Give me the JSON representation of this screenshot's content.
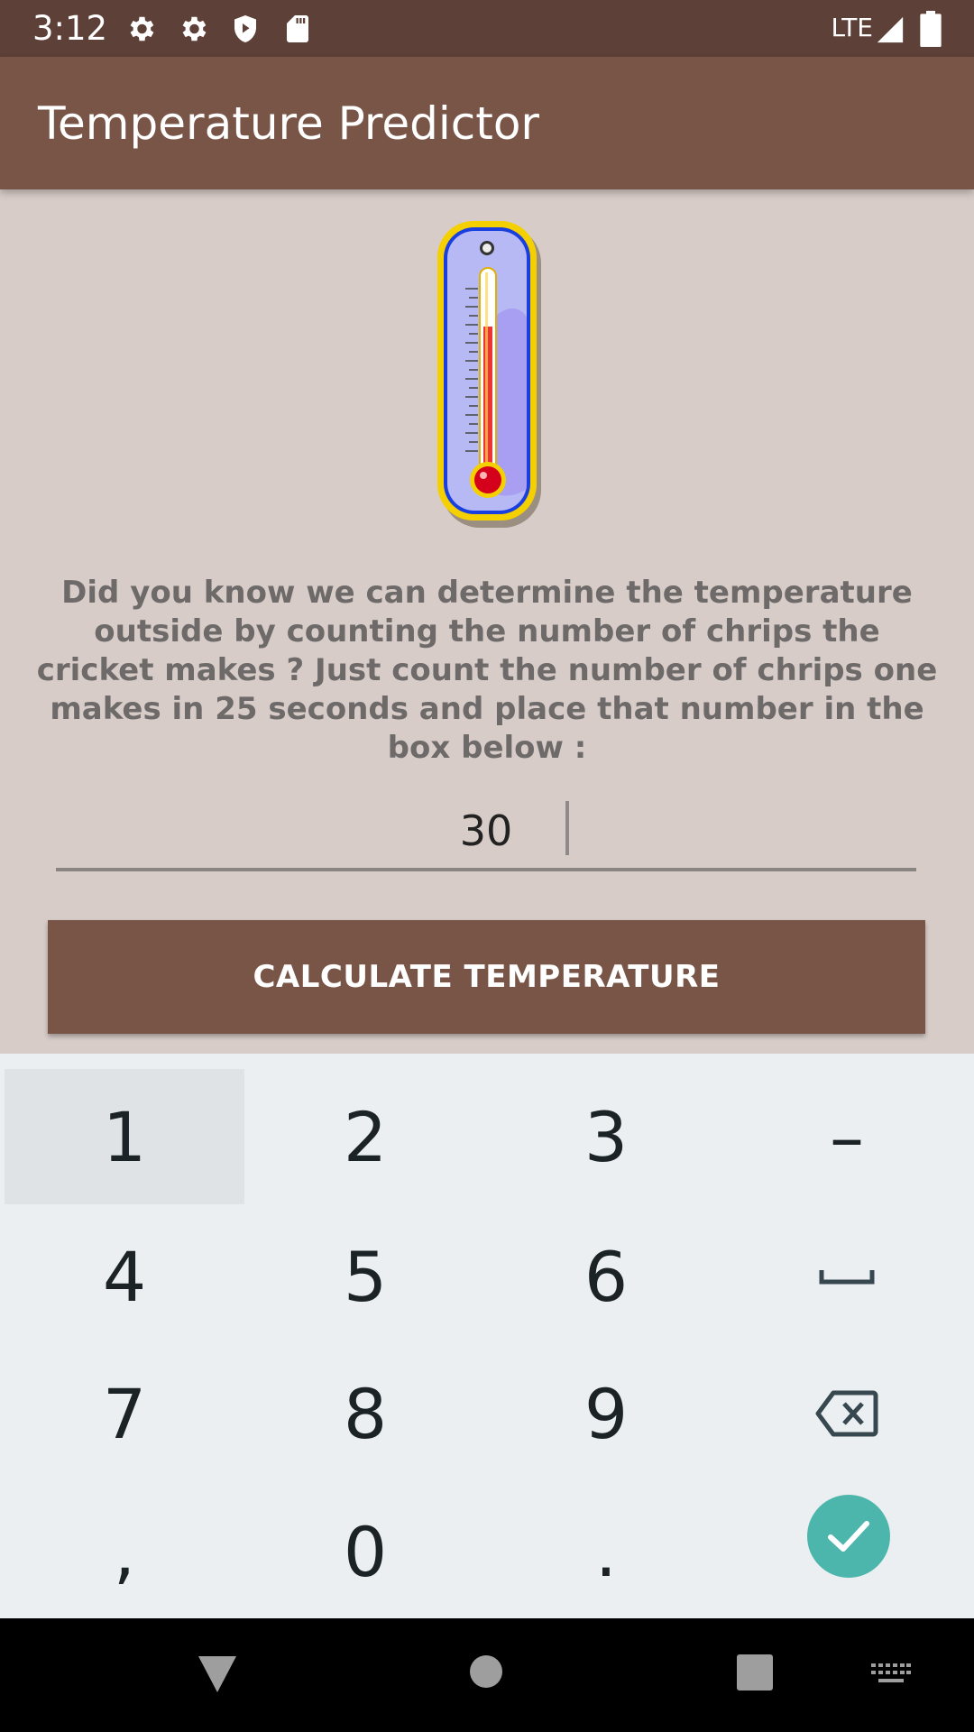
{
  "status_bar": {
    "time": "3:12",
    "network": "LTE",
    "icons": [
      "gear-icon",
      "gear-icon",
      "shield-play-icon",
      "sd-card-icon",
      "signal-icon",
      "battery-icon"
    ]
  },
  "app_bar": {
    "title": "Temperature Predictor"
  },
  "main": {
    "image_icon": "thermometer-icon",
    "intro_text": "Did you know we can determine the temperature outside by counting the number of chrips the cricket makes ? Just count the number of chrips one makes in 25 seconds and place that number in the box below :",
    "chirp_input": {
      "value": "30"
    },
    "calculate_button": "CALCULATE TEMPERATURE"
  },
  "keyboard": {
    "keys": [
      {
        "label": "1",
        "name": "key-1"
      },
      {
        "label": "2",
        "name": "key-2"
      },
      {
        "label": "3",
        "name": "key-3"
      },
      {
        "label": "–",
        "name": "key-minus"
      },
      {
        "label": "4",
        "name": "key-4"
      },
      {
        "label": "5",
        "name": "key-5"
      },
      {
        "label": "6",
        "name": "key-6"
      },
      {
        "label": "7",
        "name": "key-7"
      },
      {
        "label": "8",
        "name": "key-8"
      },
      {
        "label": "9",
        "name": "key-9"
      },
      {
        "label": ",",
        "name": "key-comma"
      },
      {
        "label": "0",
        "name": "key-0"
      },
      {
        "label": ".",
        "name": "key-period"
      }
    ],
    "icons": [
      "space-icon",
      "backspace-icon",
      "check-icon"
    ]
  },
  "nav_bar": {
    "icons": [
      "back-icon",
      "home-icon",
      "recents-icon",
      "keyboard-switch-icon"
    ]
  },
  "colors": {
    "status_bar": "#5d4037",
    "primary": "#795548",
    "background": "#d7ccc8",
    "keyboard_bg": "#eceff1",
    "accent": "#4db6ac"
  }
}
